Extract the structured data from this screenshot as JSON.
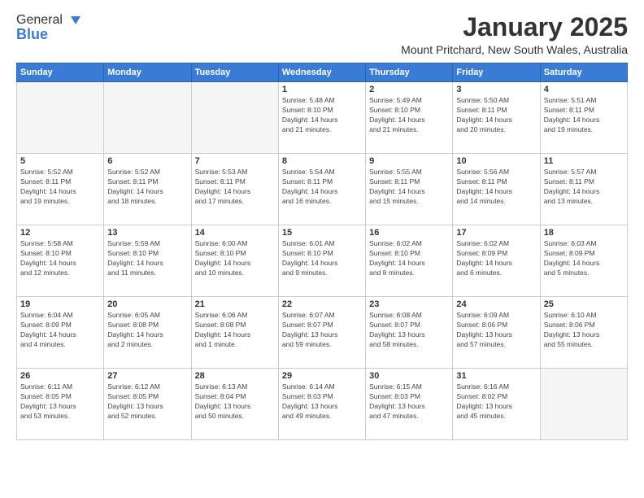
{
  "logo": {
    "general": "General",
    "blue": "Blue"
  },
  "header": {
    "title": "January 2025",
    "location": "Mount Pritchard, New South Wales, Australia"
  },
  "weekdays": [
    "Sunday",
    "Monday",
    "Tuesday",
    "Wednesday",
    "Thursday",
    "Friday",
    "Saturday"
  ],
  "weeks": [
    [
      {
        "day": "",
        "info": ""
      },
      {
        "day": "",
        "info": ""
      },
      {
        "day": "",
        "info": ""
      },
      {
        "day": "1",
        "info": "Sunrise: 5:48 AM\nSunset: 8:10 PM\nDaylight: 14 hours\nand 21 minutes."
      },
      {
        "day": "2",
        "info": "Sunrise: 5:49 AM\nSunset: 8:10 PM\nDaylight: 14 hours\nand 21 minutes."
      },
      {
        "day": "3",
        "info": "Sunrise: 5:50 AM\nSunset: 8:11 PM\nDaylight: 14 hours\nand 20 minutes."
      },
      {
        "day": "4",
        "info": "Sunrise: 5:51 AM\nSunset: 8:11 PM\nDaylight: 14 hours\nand 19 minutes."
      }
    ],
    [
      {
        "day": "5",
        "info": "Sunrise: 5:52 AM\nSunset: 8:11 PM\nDaylight: 14 hours\nand 19 minutes."
      },
      {
        "day": "6",
        "info": "Sunrise: 5:52 AM\nSunset: 8:11 PM\nDaylight: 14 hours\nand 18 minutes."
      },
      {
        "day": "7",
        "info": "Sunrise: 5:53 AM\nSunset: 8:11 PM\nDaylight: 14 hours\nand 17 minutes."
      },
      {
        "day": "8",
        "info": "Sunrise: 5:54 AM\nSunset: 8:11 PM\nDaylight: 14 hours\nand 16 minutes."
      },
      {
        "day": "9",
        "info": "Sunrise: 5:55 AM\nSunset: 8:11 PM\nDaylight: 14 hours\nand 15 minutes."
      },
      {
        "day": "10",
        "info": "Sunrise: 5:56 AM\nSunset: 8:11 PM\nDaylight: 14 hours\nand 14 minutes."
      },
      {
        "day": "11",
        "info": "Sunrise: 5:57 AM\nSunset: 8:11 PM\nDaylight: 14 hours\nand 13 minutes."
      }
    ],
    [
      {
        "day": "12",
        "info": "Sunrise: 5:58 AM\nSunset: 8:10 PM\nDaylight: 14 hours\nand 12 minutes."
      },
      {
        "day": "13",
        "info": "Sunrise: 5:59 AM\nSunset: 8:10 PM\nDaylight: 14 hours\nand 11 minutes."
      },
      {
        "day": "14",
        "info": "Sunrise: 6:00 AM\nSunset: 8:10 PM\nDaylight: 14 hours\nand 10 minutes."
      },
      {
        "day": "15",
        "info": "Sunrise: 6:01 AM\nSunset: 8:10 PM\nDaylight: 14 hours\nand 9 minutes."
      },
      {
        "day": "16",
        "info": "Sunrise: 6:02 AM\nSunset: 8:10 PM\nDaylight: 14 hours\nand 8 minutes."
      },
      {
        "day": "17",
        "info": "Sunrise: 6:02 AM\nSunset: 8:09 PM\nDaylight: 14 hours\nand 6 minutes."
      },
      {
        "day": "18",
        "info": "Sunrise: 6:03 AM\nSunset: 8:09 PM\nDaylight: 14 hours\nand 5 minutes."
      }
    ],
    [
      {
        "day": "19",
        "info": "Sunrise: 6:04 AM\nSunset: 8:09 PM\nDaylight: 14 hours\nand 4 minutes."
      },
      {
        "day": "20",
        "info": "Sunrise: 6:05 AM\nSunset: 8:08 PM\nDaylight: 14 hours\nand 2 minutes."
      },
      {
        "day": "21",
        "info": "Sunrise: 6:06 AM\nSunset: 8:08 PM\nDaylight: 14 hours\nand 1 minute."
      },
      {
        "day": "22",
        "info": "Sunrise: 6:07 AM\nSunset: 8:07 PM\nDaylight: 13 hours\nand 59 minutes."
      },
      {
        "day": "23",
        "info": "Sunrise: 6:08 AM\nSunset: 8:07 PM\nDaylight: 13 hours\nand 58 minutes."
      },
      {
        "day": "24",
        "info": "Sunrise: 6:09 AM\nSunset: 8:06 PM\nDaylight: 13 hours\nand 57 minutes."
      },
      {
        "day": "25",
        "info": "Sunrise: 6:10 AM\nSunset: 8:06 PM\nDaylight: 13 hours\nand 55 minutes."
      }
    ],
    [
      {
        "day": "26",
        "info": "Sunrise: 6:11 AM\nSunset: 8:05 PM\nDaylight: 13 hours\nand 53 minutes."
      },
      {
        "day": "27",
        "info": "Sunrise: 6:12 AM\nSunset: 8:05 PM\nDaylight: 13 hours\nand 52 minutes."
      },
      {
        "day": "28",
        "info": "Sunrise: 6:13 AM\nSunset: 8:04 PM\nDaylight: 13 hours\nand 50 minutes."
      },
      {
        "day": "29",
        "info": "Sunrise: 6:14 AM\nSunset: 8:03 PM\nDaylight: 13 hours\nand 49 minutes."
      },
      {
        "day": "30",
        "info": "Sunrise: 6:15 AM\nSunset: 8:03 PM\nDaylight: 13 hours\nand 47 minutes."
      },
      {
        "day": "31",
        "info": "Sunrise: 6:16 AM\nSunset: 8:02 PM\nDaylight: 13 hours\nand 45 minutes."
      },
      {
        "day": "",
        "info": ""
      }
    ]
  ]
}
